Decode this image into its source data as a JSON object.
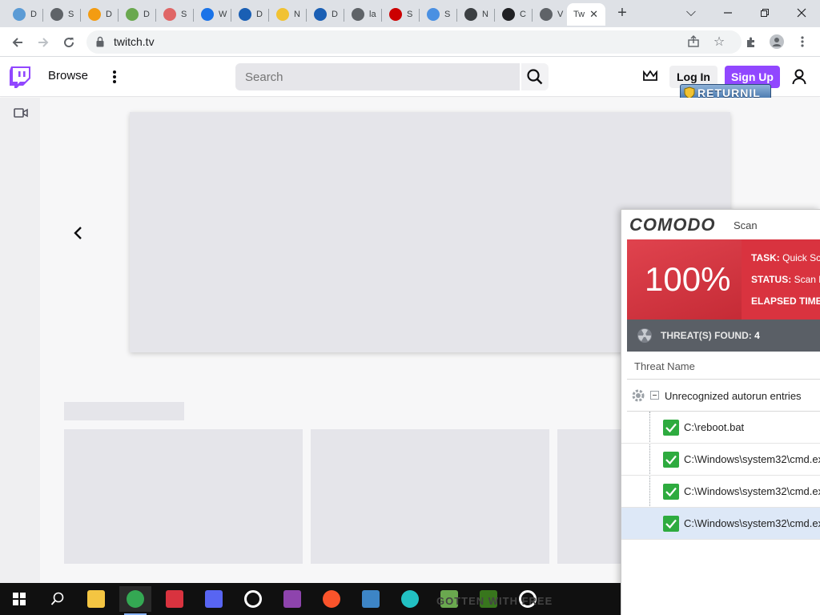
{
  "browser": {
    "tabs": [
      {
        "label": "D",
        "icon": "globe-blue-icon",
        "color": "#5b9bd5"
      },
      {
        "label": "S",
        "icon": "globe-dark-icon",
        "color": "#5f6368"
      },
      {
        "label": "D",
        "icon": "orange-circle-icon",
        "color": "#f39c12"
      },
      {
        "label": "D",
        "icon": "cloud-icon",
        "color": "#6aa84f"
      },
      {
        "label": "S",
        "icon": "rainbow-icon",
        "color": "#e06666"
      },
      {
        "label": "W",
        "icon": "shield-icon",
        "color": "#1a73e8"
      },
      {
        "label": "D",
        "icon": "network-blue-icon",
        "color": "#1a5fb4"
      },
      {
        "label": "N",
        "icon": "check-yellow-icon",
        "color": "#f1c232"
      },
      {
        "label": "D",
        "icon": "network-blue-icon",
        "color": "#1a5fb4"
      },
      {
        "label": "la",
        "icon": "globe-dark-icon",
        "color": "#5f6368"
      },
      {
        "label": "S",
        "icon": "red-bug-icon",
        "color": "#cc0000"
      },
      {
        "label": "S",
        "icon": "blue-dot-icon",
        "color": "#4a90e2"
      },
      {
        "label": "N",
        "icon": "github-icon",
        "color": "#3c4043"
      },
      {
        "label": "C",
        "icon": "obs-icon",
        "color": "#202124"
      },
      {
        "label": "V",
        "icon": "globe-dark-icon",
        "color": "#5f6368"
      }
    ],
    "active_tab": {
      "label": "Tw"
    },
    "new_tab": "+",
    "url": "twitch.tv"
  },
  "twitch": {
    "browse": "Browse",
    "search_placeholder": "Search",
    "login": "Log In",
    "signup": "Sign Up",
    "brand_color": "#9147ff"
  },
  "returnil": {
    "label": "RETURNIL"
  },
  "comodo": {
    "brand": "COMODO",
    "title": "Scan",
    "percent": "100%",
    "task_label": "TASK:",
    "task_value": "Quick Sc",
    "status_label": "STATUS:",
    "status_value": "Scan F",
    "elapsed_label": "ELAPSED TIME",
    "threats_label": "THREAT(S) FOUND:",
    "threats_count": "4",
    "column_header": "Threat Name",
    "group_label": "Unrecognized autorun entries",
    "entries": [
      {
        "path": "C:\\reboot.bat"
      },
      {
        "path": "C:\\Windows\\system32\\cmd.ex"
      },
      {
        "path": "C:\\Windows\\system32\\cmd.ex"
      },
      {
        "path": "C:\\Windows\\system32\\cmd.ex"
      }
    ],
    "header_red": "#d9333f",
    "threat_bar": "#5a5f66"
  },
  "taskbar": {
    "apps": [
      {
        "name": "file-explorer-icon",
        "color": "#f4c542"
      },
      {
        "name": "chrome-icon",
        "color": "#34a853"
      },
      {
        "name": "comodo-icon",
        "color": "#d9333f"
      },
      {
        "name": "discord-icon",
        "color": "#5865f2"
      },
      {
        "name": "settings-icon",
        "color": "#ffffff"
      },
      {
        "name": "winrar-icon",
        "color": "#8e44ad"
      },
      {
        "name": "brave-icon",
        "color": "#fb542b"
      },
      {
        "name": "tool-icon",
        "color": "#3d85c6"
      },
      {
        "name": "colorwheel-icon",
        "color": "#22c1c3"
      },
      {
        "name": "package-icon",
        "color": "#6aa84f"
      },
      {
        "name": "bug-icon",
        "color": "#38761d"
      },
      {
        "name": "obs-icon",
        "color": "#ffffff"
      }
    ],
    "overlay_text": "GOTTEN WITH FREE"
  }
}
